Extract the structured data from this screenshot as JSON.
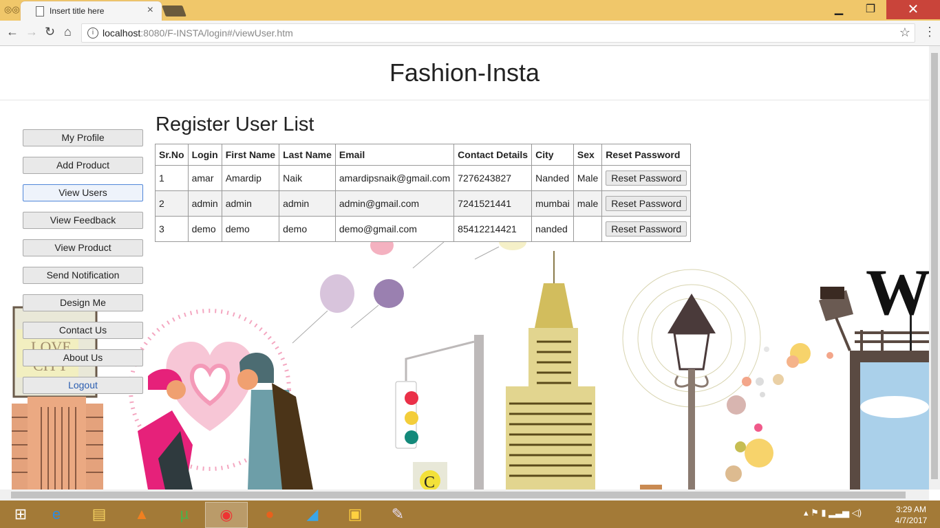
{
  "browser": {
    "tab_title": "Insert title here",
    "url_host": "localhost",
    "url_rest": ":8080/F-INSTA/login#/viewUser.htm"
  },
  "site": {
    "title": "Fashion-Insta"
  },
  "sidebar": {
    "items": [
      {
        "label": "My Profile"
      },
      {
        "label": "Add Product"
      },
      {
        "label": "View Users"
      },
      {
        "label": "View Feedback"
      },
      {
        "label": "View Product"
      },
      {
        "label": "Send Notification"
      },
      {
        "label": "Design Me"
      },
      {
        "label": "Contact Us"
      },
      {
        "label": "About Us"
      },
      {
        "label": "Logout"
      }
    ],
    "active": "View Users"
  },
  "main": {
    "heading": "Register User List",
    "columns": [
      "Sr.No",
      "Login",
      "First Name",
      "Last Name",
      "Email",
      "Contact Details",
      "City",
      "Sex",
      "Reset Password"
    ],
    "rows": [
      {
        "srno": "1",
        "login": "amar",
        "first": "Amardip",
        "last": "Naik",
        "email": "amardipsnaik@gmail.com",
        "contact": "7276243827",
        "city": "Nanded",
        "sex": "Male",
        "action": "Reset Password"
      },
      {
        "srno": "2",
        "login": "admin",
        "first": "admin",
        "last": "admin",
        "email": "admin@gmail.com",
        "contact": "7241521441",
        "city": "mumbai",
        "sex": "male",
        "action": "Reset Password"
      },
      {
        "srno": "3",
        "login": "demo",
        "first": "demo",
        "last": "demo",
        "email": "demo@gmail.com",
        "contact": "85412214421",
        "city": "nanded",
        "sex": "",
        "action": "Reset Password"
      }
    ]
  },
  "background_art": {
    "billboard_text_1": "LOVE",
    "billboard_text_2": "CITY",
    "sign_letter": "W",
    "coffee_letter": "C"
  },
  "taskbar": {
    "time": "3:29 AM",
    "date": "4/7/2017"
  },
  "colors": {
    "titlebar": "#f0c76a",
    "taskbar": "#a37a37",
    "active_border": "#4f86d9",
    "close_red": "#c9443a"
  }
}
